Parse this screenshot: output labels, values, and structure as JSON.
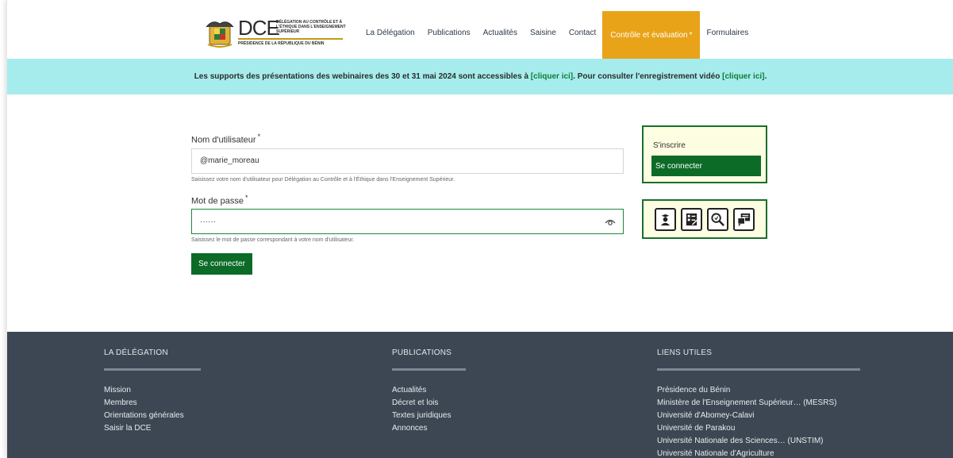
{
  "logo": {
    "letters": "DCE",
    "subtitle": "DÉLÉGATION AU CONTRÔLE ET À L'ÉTHIQUE DANS L'ENSEIGNEMENT SUPÉRIEUR",
    "presidency": "PRÉSIDENCE DE LA RÉPUBLIQUE DU BÉNIN"
  },
  "nav": {
    "items": [
      {
        "label": "La Délégation"
      },
      {
        "label": "Publications"
      },
      {
        "label": "Actualités"
      },
      {
        "label": "Saisine"
      },
      {
        "label": "Contact"
      },
      {
        "label": "Contrôle et évaluation"
      },
      {
        "label": "Formulaires"
      }
    ],
    "active_marker": "*"
  },
  "announcement": {
    "text_before": "Les supports des présentations des webinaires des 30 et 31 mai 2024 sont accessibles à ",
    "link1": "[cliquer ici]",
    "text_middle": ". Pour consulter l'enregistrement vidéo ",
    "link2": "[cliquer ici]",
    "text_after": "."
  },
  "form": {
    "username_label": "Nom d'utilisateur",
    "required_marker": "*",
    "username_value": "@marie_moreau",
    "username_hint": "Saisissez votre nom d'utilisateur pour Délégation au Contrôle et à l'Éthique dans l'Enseignement Supérieur.",
    "password_label": "Mot de passe",
    "password_value": "······",
    "password_hint": "Saisissez le mot de passe correspondant à votre nom d'utilisateur.",
    "submit_label": "Se connecter"
  },
  "side_panel": {
    "register_label": "S'inscrire",
    "login_label": "Se connecter",
    "icons": [
      "graduate-icon",
      "checklist-icon",
      "search-document-icon",
      "chat-icon"
    ]
  },
  "footer": {
    "columns": [
      {
        "heading": "LA DÉLÉGATION",
        "links": [
          "Mission",
          "Membres",
          "Orientations générales",
          "Saisir la DCE"
        ]
      },
      {
        "heading": "PUBLICATIONS",
        "links": [
          "Actualités",
          "Décret et lois",
          "Textes juridiques",
          "Annonces"
        ]
      },
      {
        "heading": "LIENS UTILES",
        "links": [
          "Présidence du Bénin",
          "Ministère de l'Enseignement Supérieur… (MESRS)",
          "Université d'Abomey-Calavi",
          "Université de Parakou",
          "Université Nationale des Sciences… (UNSTIM)",
          "Université Nationale d'Agriculture"
        ]
      }
    ]
  },
  "colors": {
    "accent_orange": "#e8a318",
    "green": "#0b6b27",
    "banner_cyan": "#a6ecec",
    "footer_bg": "#3c4753"
  }
}
